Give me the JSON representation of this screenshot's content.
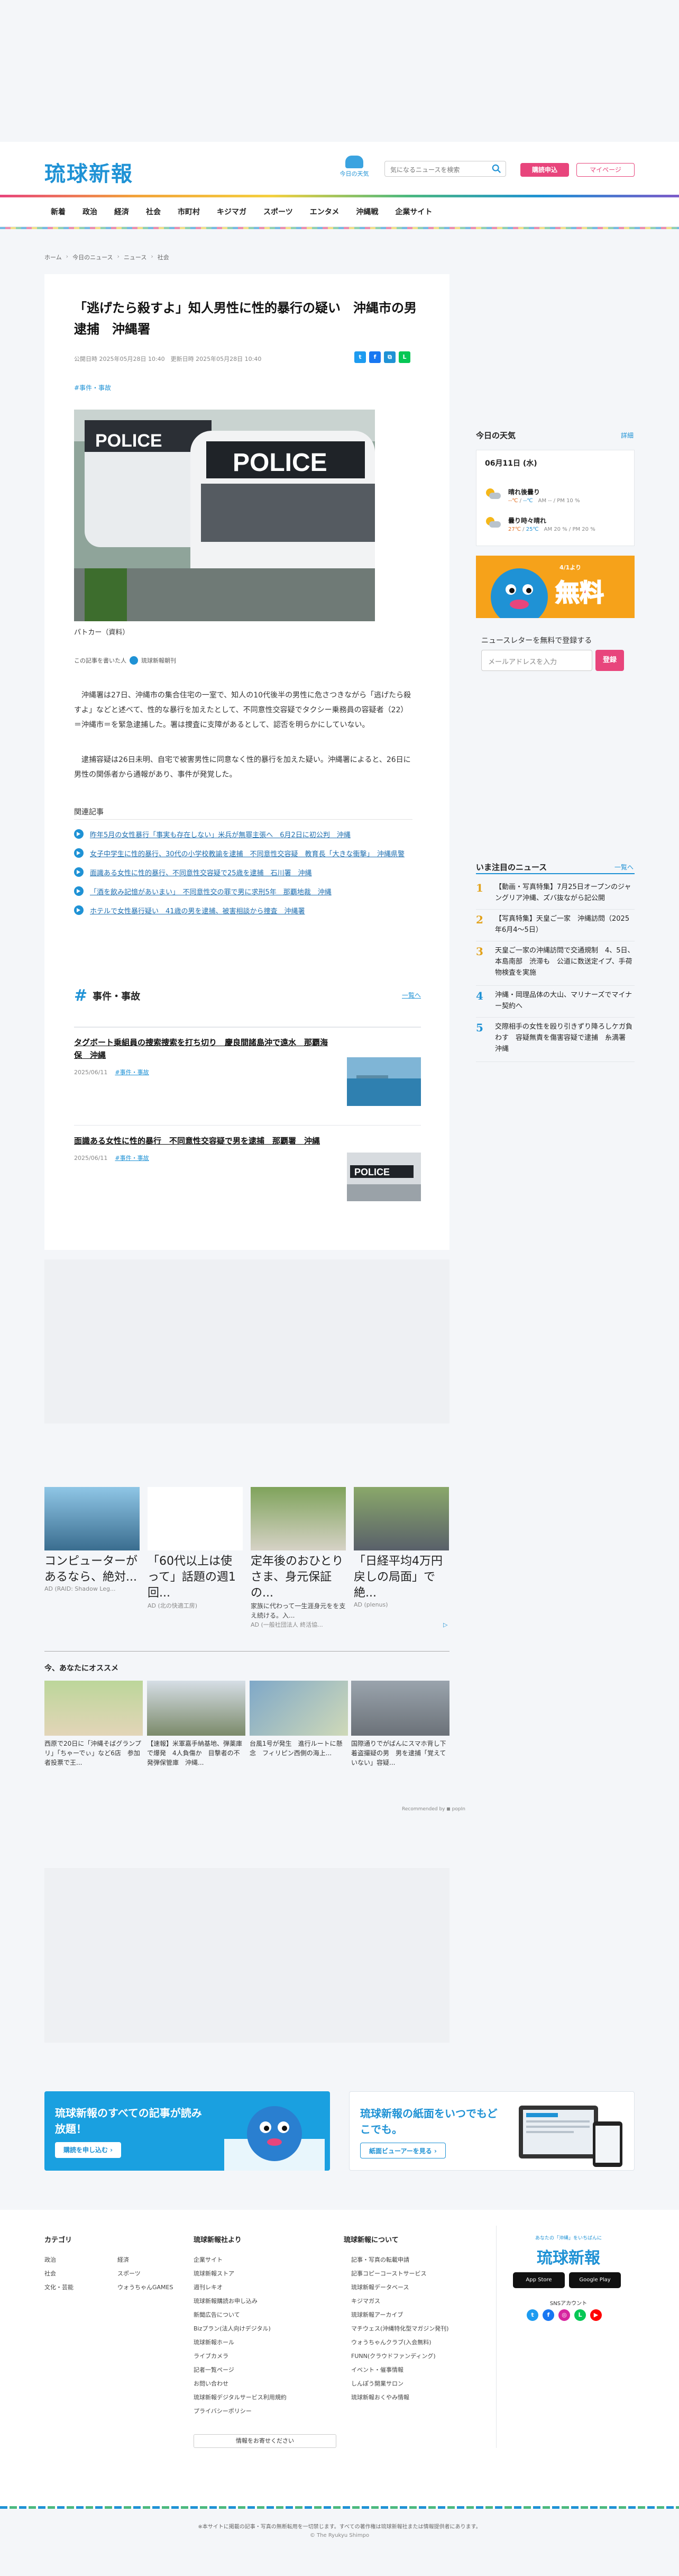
{
  "header": {
    "logo": "琉球新報",
    "weather_label": "今日の天気",
    "search_placeholder": "気になるニュースを検索",
    "subscribe": "購読申込",
    "mypage": "マイページ"
  },
  "nav": [
    "新着",
    "政治",
    "経済",
    "社会",
    "市町村",
    "キジマガ",
    "スポーツ",
    "エンタメ",
    "沖縄戦",
    "企業サイト"
  ],
  "breadcrumb": [
    "ホーム",
    "今日のニュース",
    "ニュース",
    "社会"
  ],
  "article": {
    "title": "「逃げたら殺すよ」知人男性に性的暴行の疑い　沖縄市の男逮捕　沖縄署",
    "published": "公開日時 2025年05月28日 10:40　更新日時 2025年05月28日 10:40",
    "tag": "#事件・事故",
    "photo_caption": "パトカー（資料）",
    "author_label": "この記事を書いた人",
    "author_name": "琉球新報朝刊",
    "paragraph1": "沖縄署は27日、沖縄市の集合住宅の一室で、知人の10代後半の男性に危さつきながら「逃げたら殺すよ」などと述べて、性的な暴行を加えたとして、不同意性交容疑でタクシー乗務員の容疑者（22）＝沖縄市＝を緊急逮捕した。署は捜査に支障があるとして、認否を明らかにしていない。",
    "paragraph2": "逮捕容疑は26日未明、自宅で被害男性に同意なく性的暴行を加えた疑い。沖縄署によると、26日に男性の関係者から通報があり、事件が発覚した。",
    "related_heading": "関連記事",
    "related": [
      "昨年5月の女性暴行「事実も存在しない」米兵が無罪主張へ　6月2日に初公判　沖縄",
      "女子中学生に性的暴行、30代の小学校教諭を逮捕　不同意性交容疑　教育長「大きな衝撃」　沖縄県警",
      "面識ある女性に性的暴行、不同意性交容疑で25歳を逮捕　石川署　沖縄",
      "「酒を飲み記憶があいまい」　不同意性交の罪で男に求刑5年　那覇地裁　沖縄",
      "ホテルで女性暴行疑い　41歳の男を逮捕、被害相談から捜査　沖縄署"
    ],
    "section_title": "事件・事故",
    "section_more": "一覧へ",
    "cards": [
      {
        "title": "タグボート乗組員の捜索捜索を打ち切り　慶良間諸島沖で遠水　那覇海保　沖縄",
        "date": "2025/06/11",
        "tag": "#事件・事故"
      },
      {
        "title": "面識ある女性に性的暴行　不同意性交容疑で男を逮捕　那覇署　沖縄",
        "date": "2025/06/11",
        "tag": "#事件・事故"
      }
    ]
  },
  "sidebar": {
    "weather_heading": "今日の天気",
    "weather_more": "詳細",
    "weather_date": "06月11日 (水)",
    "weather": [
      {
        "label": "晴れ後曇り",
        "hi": "--℃",
        "lo": "--℃",
        "note": "AM -- / PM 10 %"
      },
      {
        "label": "曇り時々晴れ",
        "hi": "27℃",
        "lo": "25℃",
        "note": "AM 20 % / PM 20 %"
      }
    ],
    "promo_text": "無料",
    "promo_sub": "4/1より",
    "newsletter_label": "ニュースレターを無料で登録する",
    "newsletter_placeholder": "メールアドレスを入力",
    "newsletter_button": "登録",
    "ranking_heading": "いま注目のニュース",
    "ranking_more": "一覧へ",
    "ranking": [
      {
        "n": "1",
        "t": "【動画・写真特集】7月25日オープンのジャングリア沖縄、ズバ抜ながら記公開"
      },
      {
        "n": "2",
        "t": "【写真特集】天皇ご一家　沖縄訪問（2025年6月4〜5日）"
      },
      {
        "n": "3",
        "t": "天皇ご一家の沖縄訪問で交通規制　4、5日、本島南部　渋滞も　公道に数送定イプ、手荷物検査を実施"
      },
      {
        "n": "4",
        "t": "沖縄・岡理品体の大山、マリナーズでマイナー契約へ"
      },
      {
        "n": "5",
        "t": "交際相手の女性を殴り引きずり降ろしケガ負わす　容疑無責を傷害容疑で逮捕　糸満署　沖縄"
      }
    ]
  },
  "ads": {
    "cards": [
      {
        "title": "コンピューターがあるなら、絶対...",
        "source": "AD (RAID: Shadow Leg..."
      },
      {
        "title": "「60代以上は使って」話題の週1回...",
        "source": "AD (北の快適工房)"
      },
      {
        "title": "定年後のおひとりさま、身元保証の...",
        "sub": "家族に代わって一生涯身元をを支え続ける。入...",
        "source": "AD (一般社団法人 終活協..."
      },
      {
        "title": "「日経平均4万円戻しの局面」で絶...",
        "source": "AD (plenus)"
      }
    ],
    "mark": "▷",
    "osusume_heading": "今、あなたにオススメ",
    "osusume": [
      "西原で20日に「沖縄そばグランプリ」「ちゃーでぃ」など6店　参加者投票で王...",
      "【速報】米軍嘉手納基地、弾薬庫で爆発　4人負傷か　目撃者の不発弾保管庫　沖縄...",
      "台風1号が発生　進行ルートに懸念　フィリピン西側の海上...",
      "国際通りでがばんにスマホ背し下着盗撮疑の男　男を逮捕「覚えていない」容疑..."
    ],
    "powered": "Recommended by  ◼ popIn"
  },
  "banners": {
    "left_title": "琉球新報のすべての記事が読み放題！",
    "left_button": "購読を申し込む ›",
    "right_title": "琉球新報の紙面をいつでもどこでも。",
    "right_button": "紙面ビューアーを見る ›"
  },
  "footer": {
    "col1_heading": "カテゴリ",
    "col1": [
      "政治",
      "経済",
      "社会",
      "スポーツ",
      "文化・芸能",
      "ウォうちゃんGAMES"
    ],
    "col2_heading": "琉球新報社より",
    "col2": [
      "企業サイト",
      "琉球新報ストア",
      "週刊レキオ",
      "琉球新報購読お申し込み",
      "新聞広告について",
      "Bizプラン(法人向けデジタル)",
      "琉球新報ホール",
      "ライブカメラ",
      "記者一覧ページ",
      "お問い合わせ",
      "琉球新報デジタルサービス利用規約",
      "プライバシーポリシー"
    ],
    "col3_heading": "琉球新報について",
    "col3": [
      "記事・写真の転載申請",
      "記事コピーコーストサービス",
      "琉球新報データベース",
      "キジマガス",
      "琉球新報アーカイブ",
      "マチウェス(沖縄特化型マガジン発刊)",
      "ウォうちゃんクラブ(入会無料)",
      "FUNN(クラウドファンディング)",
      "イベント・催事情報",
      "しんぽう開業サロン",
      "琉球新報おくやみ情報"
    ],
    "cta": "情報をお寄せください",
    "logo_tag": "あなたの「沖縄」をいちばんに",
    "logo": "琉球新報",
    "app_store": "App Store",
    "google_play": "Google Play",
    "sns_heading": "SNSアカウント",
    "copy_note": "※本サイトに掲載の記事・写真の無断転用を一切禁じます。すべての著作権は琉球新報社または情報提供者にあります。",
    "copyright": "© The Ryukyu Shimpo"
  },
  "colors": {
    "brand": "#1f92d5",
    "accent": "#e8457c"
  }
}
